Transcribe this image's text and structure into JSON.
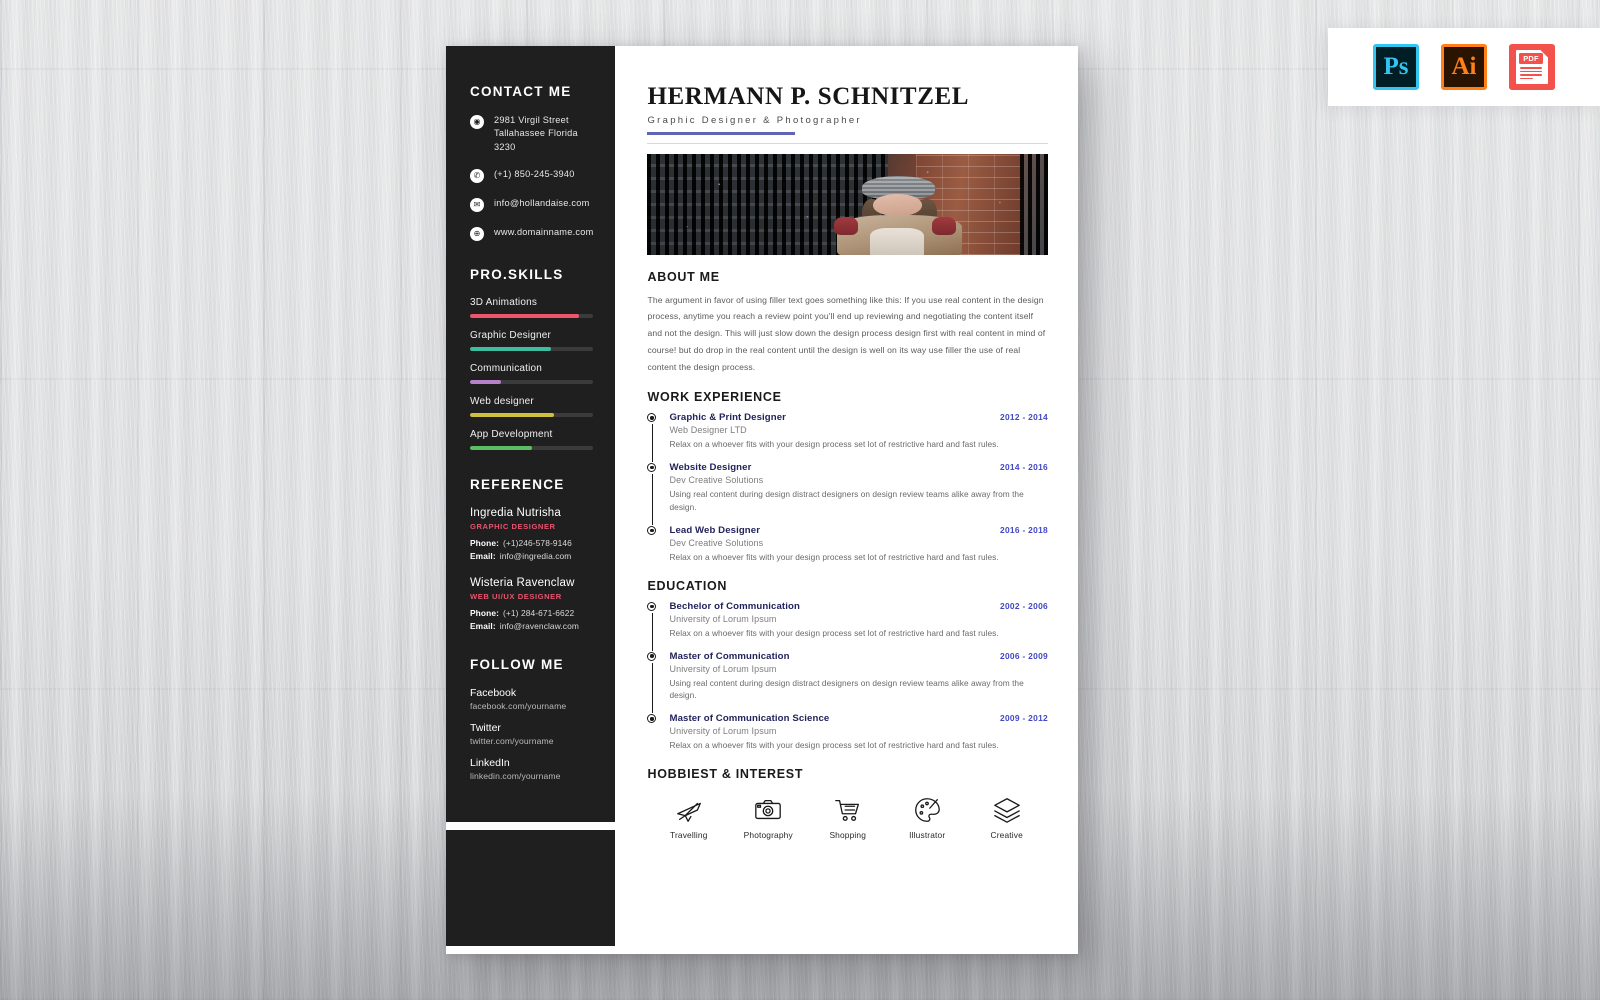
{
  "mockup": {
    "background_color": "#dcdddf",
    "sheet_color": "#ffffff",
    "accent_purple": "#6066b3",
    "sidebar_color": "#1f1f1f"
  },
  "badges": [
    {
      "name": "photoshop-badge",
      "label": "Ps",
      "color": "#31c5f0"
    },
    {
      "name": "illustrator-badge",
      "label": "Ai",
      "color": "#ff7f18"
    },
    {
      "name": "pdf-badge",
      "label": "PDF",
      "color": "#f3514c"
    }
  ],
  "sidebar": {
    "contact": {
      "heading": "CONTACT ME",
      "items": [
        {
          "icon": "location-icon",
          "glyph": "◉",
          "text": "2981 Virgil Street Tallahassee Florida 3230"
        },
        {
          "icon": "phone-icon",
          "glyph": "✆",
          "text": "(+1) 850-245-3940"
        },
        {
          "icon": "email-icon",
          "glyph": "✉",
          "text": "info@hollandaise.com"
        },
        {
          "icon": "globe-icon",
          "glyph": "⊕",
          "text": "www.domainname.com"
        }
      ]
    },
    "skills": {
      "heading": "PRO.SKILLS",
      "items": [
        {
          "label": "3D Animations",
          "percent": 88,
          "color": "#f0556d"
        },
        {
          "label": "Graphic Designer",
          "percent": 66,
          "color": "#3cbd9e"
        },
        {
          "label": "Communication",
          "percent": 25,
          "color": "#b581c8"
        },
        {
          "label": "Web designer",
          "percent": 68,
          "color": "#d1c03f"
        },
        {
          "label": "App Development",
          "percent": 50,
          "color": "#5bbf61"
        }
      ]
    },
    "reference": {
      "heading": "REFERENCE",
      "items": [
        {
          "name": "Ingredia Nutrisha",
          "role": "GRAPHIC DESIGNER",
          "phone_label": "Phone:",
          "phone": "(+1)246-578-9146",
          "email_label": "Email:",
          "email": "info@ingredia.com"
        },
        {
          "name": "Wisteria Ravenclaw",
          "role": "WEB UI/UX DESIGNER",
          "phone_label": "Phone:",
          "phone": "(+1) 284-671-6622",
          "email_label": "Email:",
          "email": "info@ravenclaw.com"
        }
      ]
    },
    "follow": {
      "heading": "FOLLOW ME",
      "items": [
        {
          "network": "Facebook",
          "url": "facebook.com/yourname"
        },
        {
          "network": "Twitter",
          "url": "twitter.com/yourname"
        },
        {
          "network": "LinkedIn",
          "url": "linkedin.com/yourname"
        }
      ]
    }
  },
  "main": {
    "name": "HERMANN P. SCHNITZEL",
    "role": "Graphic Designer & Photographer",
    "photo_alt": "portrait-photo",
    "about": {
      "heading": "ABOUT ME",
      "text": "The argument in favor of using filler text goes something like this: If you use real content in the design process, anytime you reach a review point you'll end up reviewing and negotiating the content itself and not the design. This will just slow down the design process design first with real content in mind of course! but do drop in the real content until the design is well on its way use filler the use of real content the design process."
    },
    "experience": {
      "heading": "WORK EXPERIENCE",
      "items": [
        {
          "title": "Graphic & Print Designer",
          "org": "Web Designer LTD",
          "date": "2012 - 2014",
          "desc": "Relax on a whoever fits with your design process set lot of restrictive hard and fast rules."
        },
        {
          "title": "Website Designer",
          "org": "Dev Creative Solutions",
          "date": "2014 - 2016",
          "desc": "Using real content during design distract designers on design review teams alike away from the design."
        },
        {
          "title": "Lead Web Designer",
          "org": "Dev Creative Solutions",
          "date": "2016 - 2018",
          "desc": "Relax on a whoever fits with your design process set lot of restrictive hard and fast rules."
        }
      ]
    },
    "education": {
      "heading": "EDUCATION",
      "items": [
        {
          "title": "Bechelor of Communication",
          "org": "University of Lorum Ipsum",
          "date": "2002 - 2006",
          "desc": "Relax on a whoever fits with your design process set lot of restrictive hard and fast rules."
        },
        {
          "title": "Master of Communication",
          "org": "University of Lorum Ipsum",
          "date": "2006 - 2009",
          "desc": "Using real content during design distract designers on design review teams alike away from the design."
        },
        {
          "title": "Master of Communication Science",
          "org": "University of Lorum Ipsum",
          "date": "2009 - 2012",
          "desc": "Relax on a whoever fits with your design process set lot of restrictive hard and fast rules."
        }
      ]
    },
    "hobbies": {
      "heading": "HOBBIEST & INTEREST",
      "items": [
        {
          "icon": "airplane-icon",
          "label": "Travelling"
        },
        {
          "icon": "camera-icon",
          "label": "Photography"
        },
        {
          "icon": "shopping-cart-icon",
          "label": "Shopping"
        },
        {
          "icon": "palette-icon",
          "label": "Illustrator"
        },
        {
          "icon": "layers-icon",
          "label": "Creative"
        }
      ]
    }
  }
}
